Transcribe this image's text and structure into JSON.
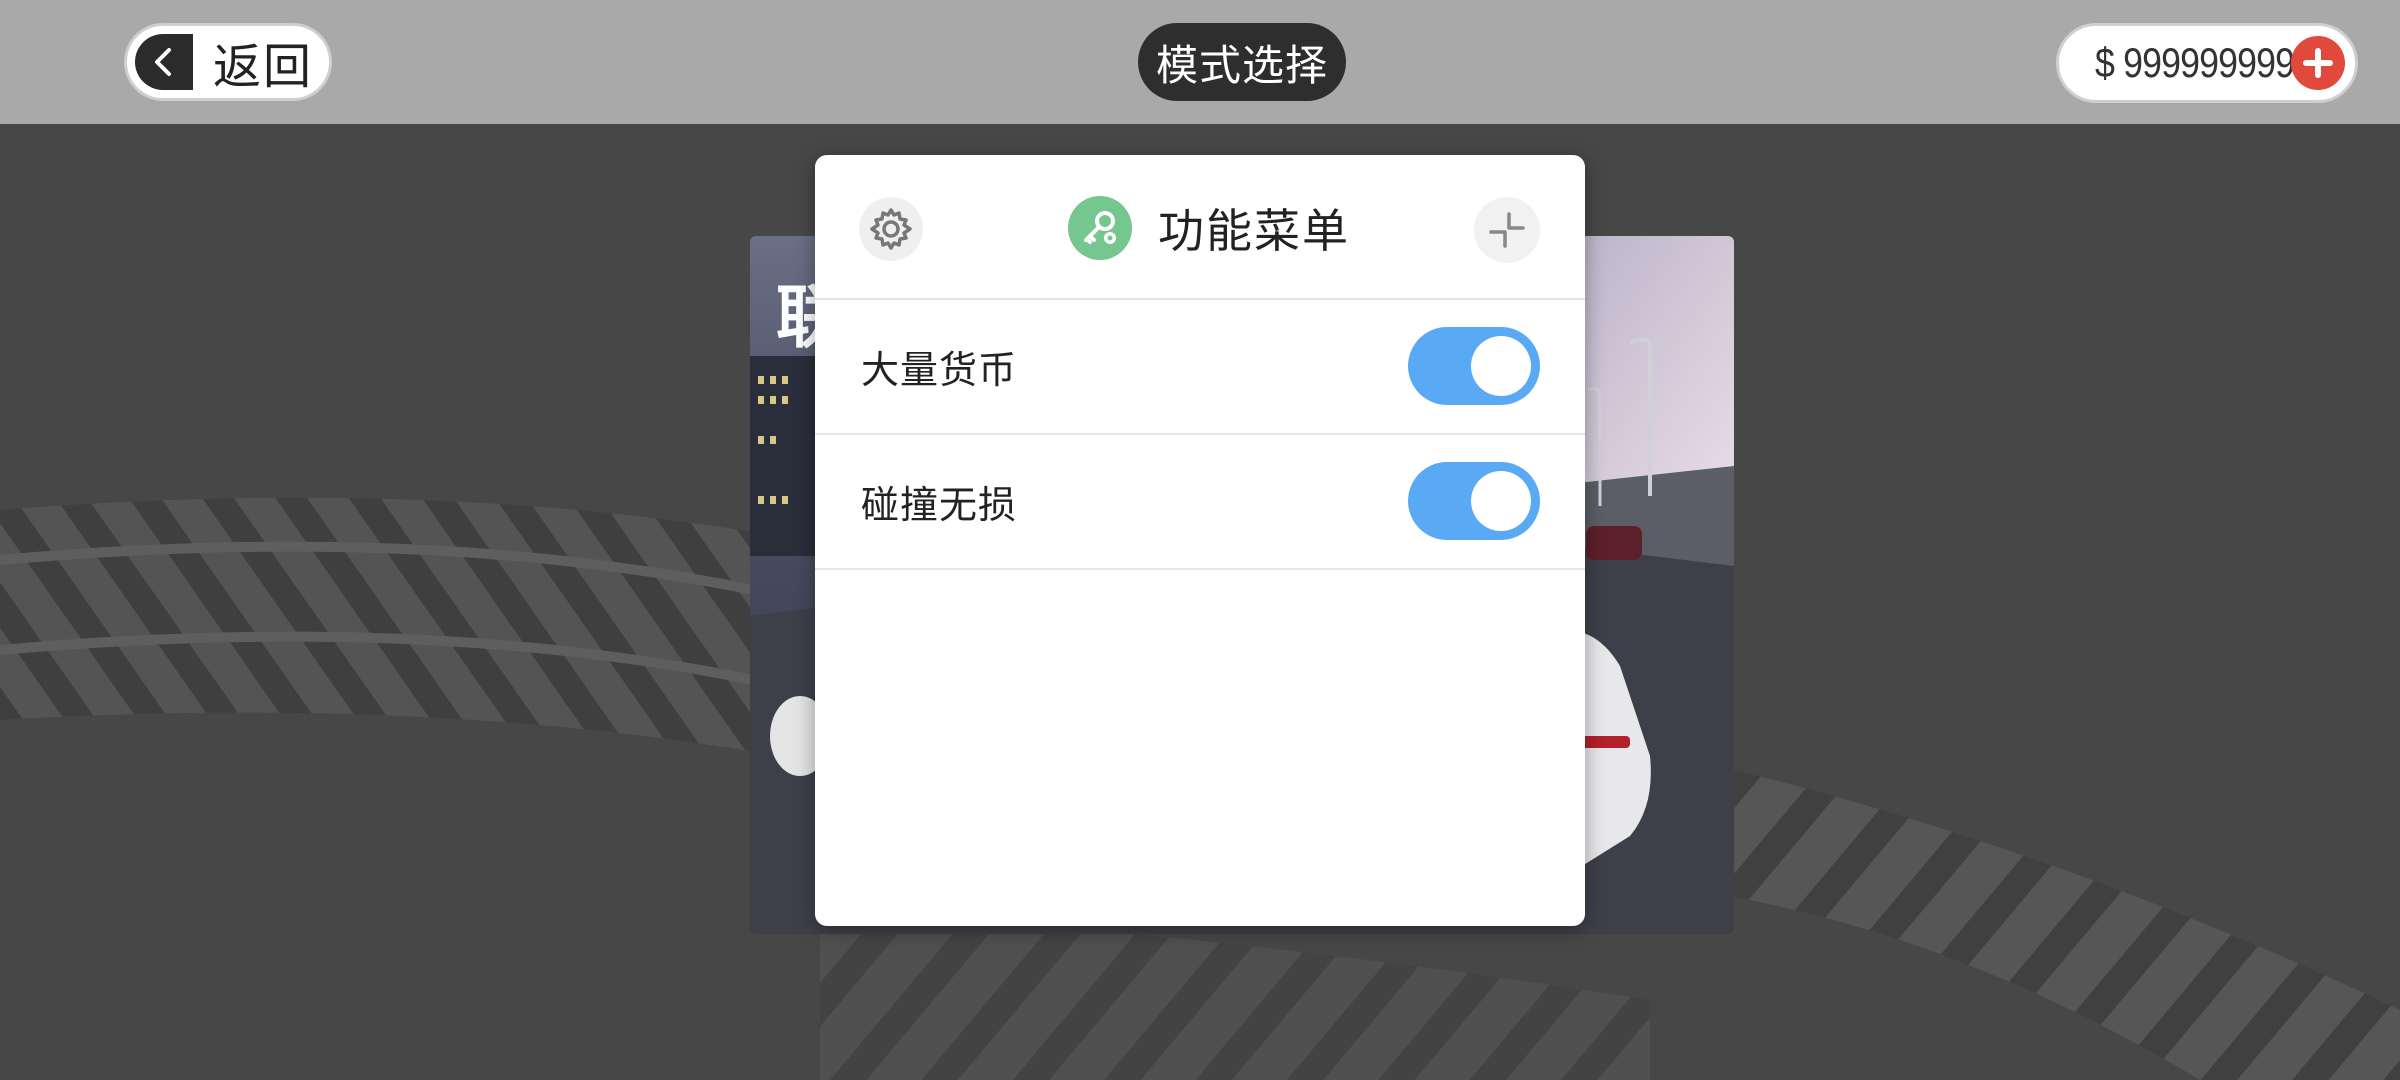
{
  "topbar": {
    "back_label": "返回",
    "mode_title": "模式选择",
    "money": "$ 999999999"
  },
  "card": {
    "title_fragment": "联"
  },
  "menu": {
    "title": "功能菜单",
    "items": [
      {
        "label": "大量货币",
        "enabled": true
      },
      {
        "label": "碰撞无损",
        "enabled": true
      }
    ]
  },
  "colors": {
    "topbar_bg": "#a9a9a9",
    "background": "#474747",
    "toggle_on": "#5aa9f4",
    "add_button": "#e0493b",
    "app_icon": "#75c78f"
  },
  "icons": {
    "back": "chevron-left-icon",
    "add": "plus-circle-icon",
    "settings": "gear-icon",
    "app": "key-icon",
    "collapse": "collapse-icon"
  }
}
